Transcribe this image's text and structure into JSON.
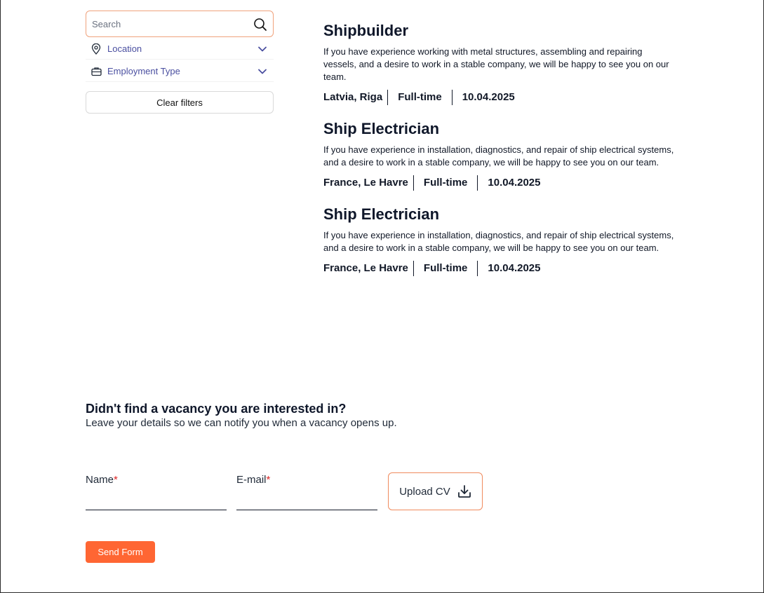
{
  "search": {
    "placeholder": "Search"
  },
  "filters": [
    {
      "label": "Location",
      "icon": "location-pin-icon"
    },
    {
      "label": "Employment Type",
      "icon": "briefcase-icon"
    }
  ],
  "clear_filters_label": "Clear filters",
  "vacancies": [
    {
      "title": "Shipbuilder",
      "description": "If you have experience working with metal structures, assembling and repairing vessels, and a desire to work in a stable company, we will be happy to see you on our team.",
      "location": "Latvia, Riga",
      "employment_type": "Full-time",
      "date": "10.04.2025"
    },
    {
      "title": "Ship Electrician",
      "description": "If you have experience in installation, diagnostics, and repair of ship electrical systems, and a desire to work in a stable company, we will be happy to see you on our team.",
      "location": "France, Le Havre",
      "employment_type": "Full-time",
      "date": "10.04.2025"
    },
    {
      "title": "Ship Electrician",
      "description": "If you have experience in installation, diagnostics, and repair of ship electrical systems, and a desire to work in a stable company, we will be happy to see you on our team.",
      "location": "France, Le Havre",
      "employment_type": "Full-time",
      "date": "10.04.2025"
    }
  ],
  "cta": {
    "heading": "Didn't find a vacancy you are interested in?",
    "subtext": "Leave your details so we can notify you when a vacancy opens up."
  },
  "form": {
    "name_label": "Name",
    "email_label": "E-mail",
    "required_mark": "*",
    "name_value": "",
    "email_value": "",
    "upload_label": "Upload CV",
    "send_label": "Send Form"
  },
  "colors": {
    "accent": "#ff6633",
    "accent_border": "#f0a27c",
    "filter_label": "#4a4fa0",
    "required": "#dc2626"
  }
}
